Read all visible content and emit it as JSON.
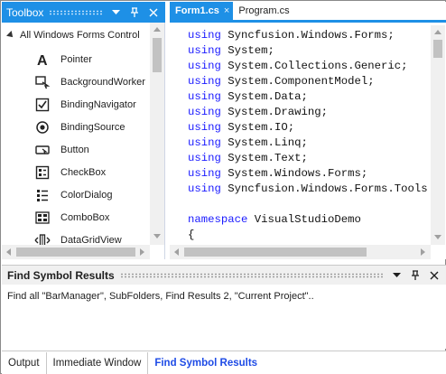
{
  "toolbox": {
    "title": "Toolbox",
    "category": "All Windows Forms Control",
    "items": [
      {
        "label": "Pointer",
        "icon": "pointer-icon"
      },
      {
        "label": "BackgroundWorker",
        "icon": "background-worker-icon"
      },
      {
        "label": "BindingNavigator",
        "icon": "binding-navigator-icon"
      },
      {
        "label": "BindingSource",
        "icon": "binding-source-icon"
      },
      {
        "label": "Button",
        "icon": "button-icon"
      },
      {
        "label": "CheckBox",
        "icon": "checkbox-icon"
      },
      {
        "label": "ColorDialog",
        "icon": "color-dialog-icon"
      },
      {
        "label": "ComboBox",
        "icon": "combobox-icon"
      },
      {
        "label": "DataGridView",
        "icon": "datagridview-icon"
      }
    ]
  },
  "editor": {
    "tabs": [
      {
        "label": "Form1.cs",
        "close": "×",
        "active": true
      },
      {
        "label": "Program.cs",
        "active": false
      }
    ],
    "lines": [
      {
        "kw": "using",
        "rest": " Syncfusion.Windows.Forms;"
      },
      {
        "kw": "using",
        "rest": " System;"
      },
      {
        "kw": "using",
        "rest": " System.Collections.Generic;"
      },
      {
        "kw": "using",
        "rest": " System.ComponentModel;"
      },
      {
        "kw": "using",
        "rest": " System.Data;"
      },
      {
        "kw": "using",
        "rest": " System.Drawing;"
      },
      {
        "kw": "using",
        "rest": " System.IO;"
      },
      {
        "kw": "using",
        "rest": " System.Linq;"
      },
      {
        "kw": "using",
        "rest": " System.Text;"
      },
      {
        "kw": "using",
        "rest": " System.Windows.Forms;"
      },
      {
        "kw": "using",
        "rest": " Syncfusion.Windows.Forms.Tools;"
      },
      {
        "kw": "",
        "rest": ""
      },
      {
        "kw": "namespace",
        "rest": " VisualStudioDemo"
      },
      {
        "kw": "",
        "rest": "{"
      }
    ]
  },
  "results": {
    "title": "Find Symbol Results",
    "text": "Find all \"BarManager\", SubFolders, Find Results 2, \"Current Project\".."
  },
  "bottom_tabs": [
    {
      "label": "Output",
      "active": false
    },
    {
      "label": "Immediate Window",
      "active": false
    },
    {
      "label": "Find Symbol Results",
      "active": true
    }
  ],
  "colors": {
    "accent": "#1e90e6",
    "keyword": "#1a1aff",
    "active_tab_text": "#1e4be6"
  }
}
